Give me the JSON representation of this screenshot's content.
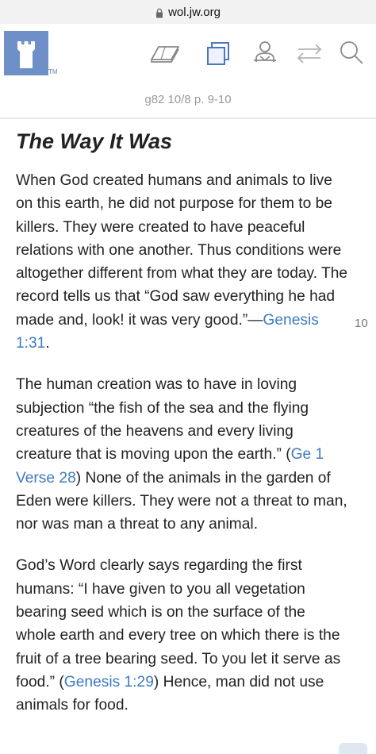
{
  "browser": {
    "url": "wol.jw.org"
  },
  "header": {
    "logo_tm": "TM",
    "icons": [
      "book-icon",
      "duplicate-icon",
      "user-at-desk-icon",
      "swap-arrows-icon",
      "search-icon"
    ]
  },
  "reference": "g82 10/8 p. 9-10",
  "article": {
    "title": "The Way It Was",
    "p1_text": "When God created humans and animals to live on this earth, he did not purpose for them to be killers. They were created to have peaceful relations with one another. Thus conditions were altogether different from what they are today. The record tells us that “God saw everything he had made and, look! it was very good.”—",
    "p1_link": "Genesis 1:31",
    "p1_end": ".",
    "p2_text": "The human creation was to have in loving subjection “the fish of the sea and the flying creatures of the heavens and every living creature that is moving upon the earth.” (",
    "p2_link": "Ge 1 Verse 28",
    "p2_end": ") None of the animals in the garden of Eden were killers. They were not a threat to man, nor was man a threat to any animal.",
    "p3_text": "God’s Word clearly says regarding the first humans: “I have given to you all vegetation bearing seed which is on the surface of the whole earth and every tree on which there is the fruit of a tree bearing seed. To you let it serve as food.” (",
    "p3_link": "Genesis 1:29",
    "p3_end": ") Hence, man did not use animals for food.",
    "margin_number": "10"
  }
}
